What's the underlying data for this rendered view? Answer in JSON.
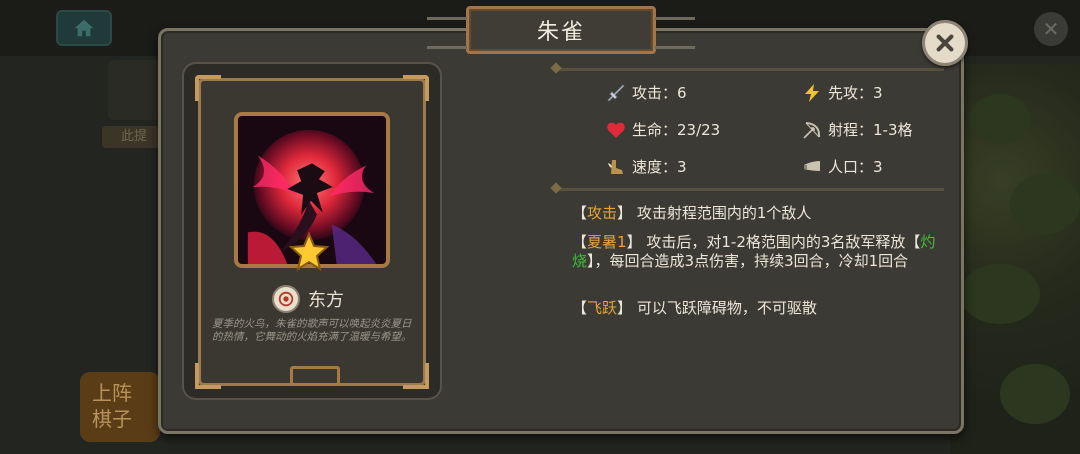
{
  "unit": {
    "name": "朱雀",
    "faction": "东方",
    "stars": 1,
    "lore": "夏季的火鸟，朱雀的歌声可以唤起炎炎夏日的热情，它舞动的火焰充满了温暖与希望。"
  },
  "stats": {
    "attack": {
      "label": "攻击：6",
      "icon": "sword-icon"
    },
    "initiative": {
      "label": "先攻：3",
      "icon": "lightning-icon"
    },
    "health": {
      "label": "生命：23/23",
      "icon": "heart-icon"
    },
    "range": {
      "label": "射程：1-3格",
      "icon": "bow-icon"
    },
    "speed": {
      "label": "速度：3",
      "icon": "wing-boot-icon"
    },
    "population": {
      "label": "人口：3",
      "icon": "horn-icon"
    }
  },
  "skills": [
    {
      "open": "【",
      "name": "攻击",
      "close": "】",
      "text": "攻击射程范围内的1个敌人"
    },
    {
      "open": "【",
      "name": "夏暑1",
      "close": "】",
      "text_a": "攻击后，对1-2格范围内的3名敌军释放",
      "kw_open": "【",
      "kw": "灼烧",
      "kw_close": "】",
      "text_b": "，每回合造成3点伤害，持续3回合，冷却1回合"
    },
    {
      "open": "【",
      "name": "飞跃",
      "close": "】",
      "text": "可以飞跃障碍物，不可驱散"
    }
  ],
  "background": {
    "tag": "此提",
    "button": "上阵棋子"
  },
  "colors": {
    "panel": "#3b3a34",
    "gold_frame": "#a77a43",
    "keyword": "#e3a53c",
    "status_keyword": "#3fbf3a"
  }
}
